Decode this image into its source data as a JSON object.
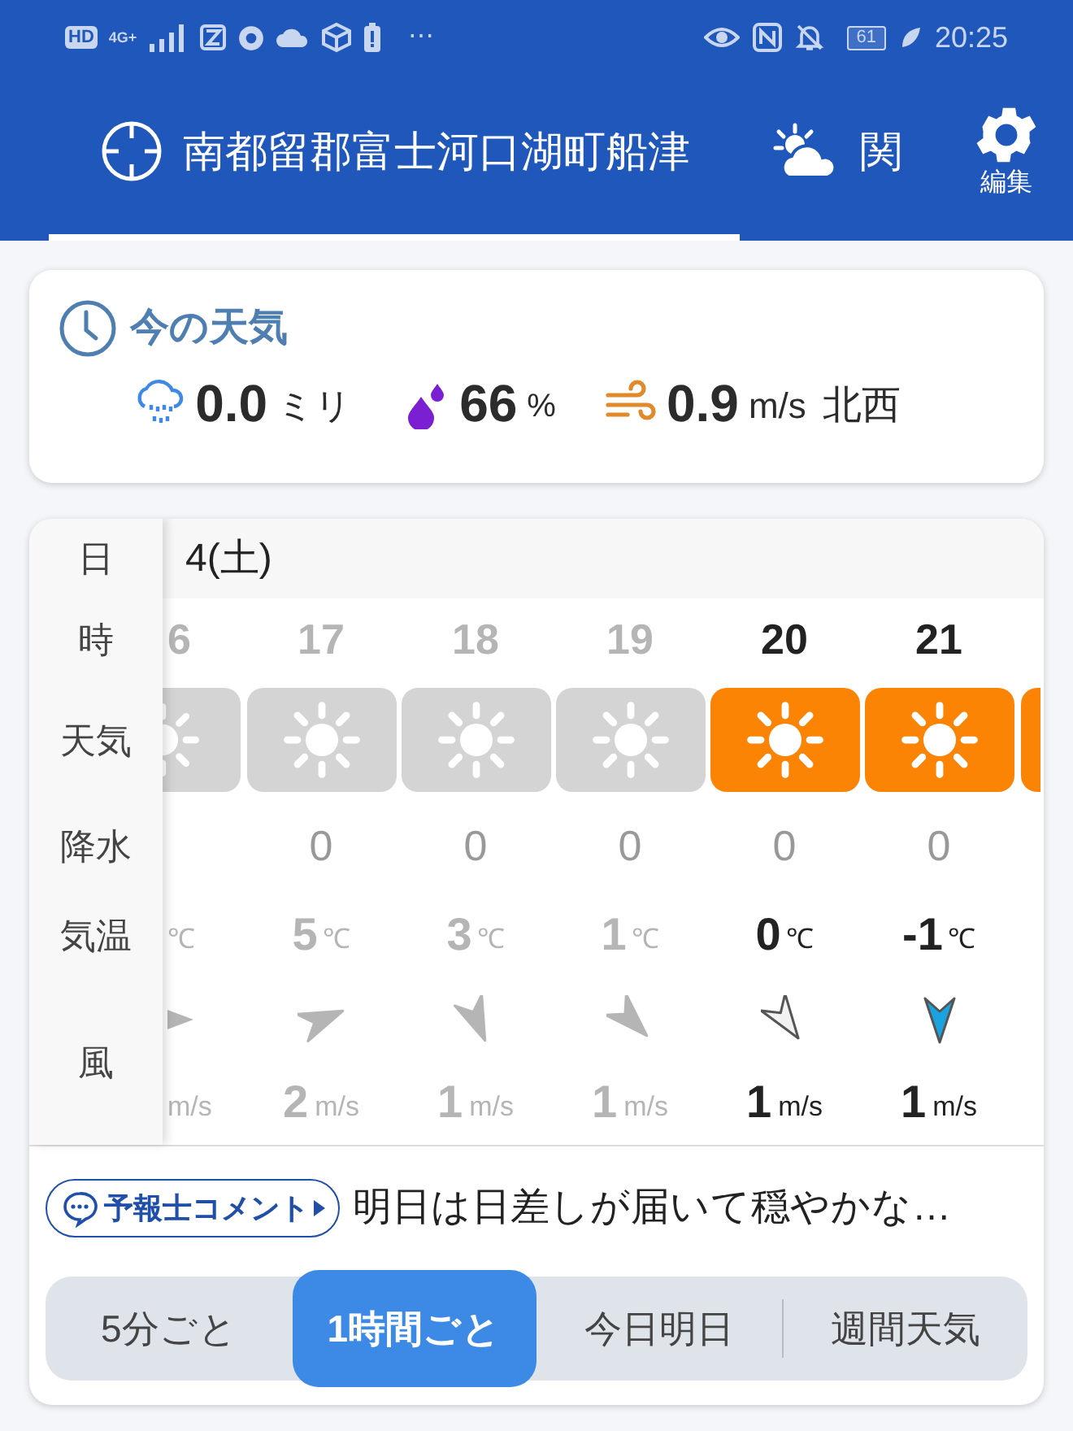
{
  "status_bar": {
    "hd": "HD",
    "network": "4G+",
    "more": "⋯",
    "battery": "61",
    "time": "20:25"
  },
  "header": {
    "tabs": [
      {
        "kind": "location",
        "label": "南都留郡富士河口湖町船津",
        "selected": true
      },
      {
        "kind": "region",
        "label": "関",
        "selected": false
      }
    ],
    "settings_label": "編集"
  },
  "current": {
    "title": "今の天気",
    "precipitation": {
      "value": "0.0",
      "unit": "ミリ"
    },
    "humidity": {
      "value": "66",
      "unit": "%"
    },
    "wind": {
      "value": "0.9",
      "unit": "m/s",
      "direction": "北西"
    }
  },
  "hourly": {
    "row_labels": [
      "日",
      "時",
      "天気",
      "降水",
      "気温",
      "風"
    ],
    "date": "4(土)",
    "columns": [
      {
        "kind": "partial_left",
        "past": true,
        "hour": "6",
        "temp_unit": "℃",
        "speed_unit": "m/s"
      },
      {
        "kind": "full",
        "past": true,
        "hour": "17",
        "precipitation": "0",
        "temp": "5",
        "temp_unit": "℃",
        "wind_speed": "2",
        "speed_unit": "m/s"
      },
      {
        "kind": "full",
        "past": true,
        "hour": "18",
        "precipitation": "0",
        "temp": "3",
        "temp_unit": "℃",
        "wind_speed": "1",
        "speed_unit": "m/s"
      },
      {
        "kind": "full",
        "past": true,
        "hour": "19",
        "precipitation": "0",
        "temp": "1",
        "temp_unit": "℃",
        "wind_speed": "1",
        "speed_unit": "m/s"
      },
      {
        "kind": "full",
        "past": false,
        "hour": "20",
        "precipitation": "0",
        "temp": "0",
        "temp_unit": "℃",
        "wind_speed": "1",
        "speed_unit": "m/s"
      },
      {
        "kind": "full",
        "past": false,
        "hour": "21",
        "precipitation": "0",
        "temp": "-1",
        "temp_unit": "℃",
        "wind_speed": "1",
        "speed_unit": "m/s"
      },
      {
        "kind": "partial_right",
        "past": false
      }
    ]
  },
  "comment": {
    "badge": "予報士コメント",
    "text": "明日は日差しが届いて穏やかな…"
  },
  "modes": [
    {
      "label": "5分ごと",
      "selected": false
    },
    {
      "label": "1時間ごと",
      "selected": true
    },
    {
      "label": "今日明日",
      "selected": false
    },
    {
      "label": "週間天気",
      "selected": false
    }
  ]
}
